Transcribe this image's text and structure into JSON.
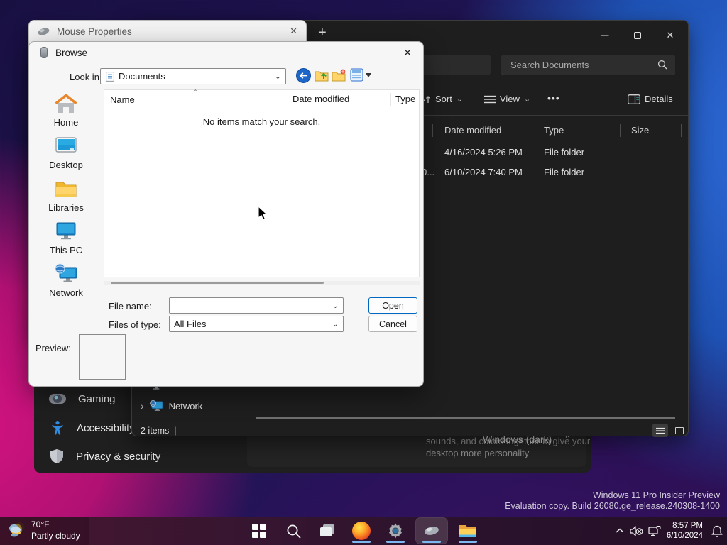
{
  "icons": {
    "chevron_down": "⌄",
    "chevron_up": "⌃",
    "chevron_right": "›",
    "ellipsis": "•••",
    "close": "✕",
    "minimize": "—",
    "plus": "+",
    "sort_caret": "ˆ",
    "text_cursor": "|"
  },
  "mouse_properties": {
    "title": "Mouse Properties"
  },
  "browse_dialog": {
    "title": "Browse",
    "look_in_label": "Look in:",
    "look_in_value": "Documents",
    "sidebar_items": [
      {
        "label": "Home"
      },
      {
        "label": "Desktop"
      },
      {
        "label": "Libraries"
      },
      {
        "label": "This PC"
      },
      {
        "label": "Network"
      }
    ],
    "list": {
      "col_name": "Name",
      "col_date": "Date modified",
      "col_type": "Type",
      "empty_message": "No items match your search."
    },
    "file_name_label": "File name:",
    "files_of_type_label": "Files of type:",
    "files_of_type_value": "All Files",
    "open_label": "Open",
    "cancel_label": "Cancel",
    "preview_label": "Preview:"
  },
  "explorer": {
    "search_placeholder": "Search Documents",
    "toolbar": {
      "sort_label": "Sort",
      "view_label": "View",
      "details_label": "Details"
    },
    "columns": {
      "date": "Date modified",
      "type": "Type",
      "size": "Size"
    },
    "rows": [
      {
        "name_fragment": "",
        "date_modified": "4/16/2024 5:26 PM",
        "type": "File folder",
        "size": ""
      },
      {
        "name_fragment": "0...",
        "date_modified": "6/10/2024 7:40 PM",
        "type": "File folder",
        "size": ""
      }
    ],
    "nav": {
      "this_pc": "This PC",
      "network": "Network"
    },
    "status_text": "2 items"
  },
  "settings": {
    "items": [
      {
        "label": "Gaming"
      },
      {
        "label": "Accessibility"
      },
      {
        "label": "Privacy & security"
      }
    ],
    "theme_description": "choose a combination of wallpapers, sounds, and colors together to give your desktop more personality",
    "theme_value": "Windows (dark)"
  },
  "taskbar": {
    "weather_temp": "70°F",
    "weather_desc": "Partly cloudy",
    "time": "8:57 PM",
    "date": "6/10/2024"
  },
  "watermark": {
    "line1": "Windows 11 Pro Insider Preview",
    "line2": "Evaluation copy. Build 26080.ge_release.240308-1400"
  }
}
